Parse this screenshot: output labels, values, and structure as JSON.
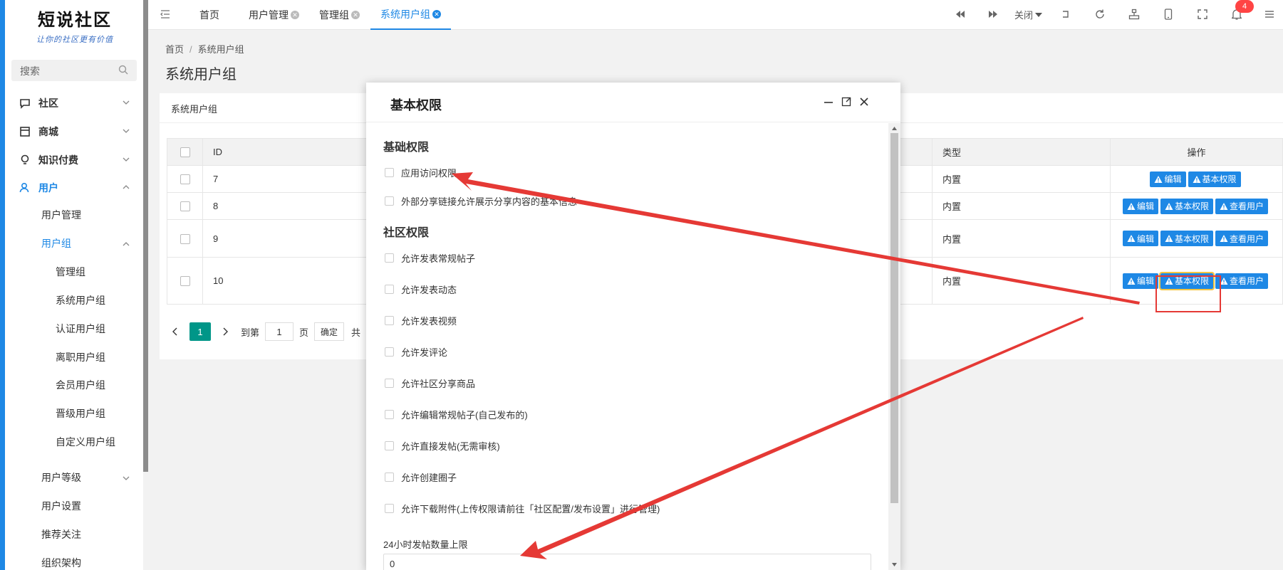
{
  "logo": {
    "title": "短说社区",
    "subtitle": "让你的社区更有价值"
  },
  "search": {
    "placeholder": "搜索"
  },
  "sidebar": {
    "items": [
      {
        "label": "社区",
        "icon": "chat-icon"
      },
      {
        "label": "商城",
        "icon": "store-icon"
      },
      {
        "label": "知识付费",
        "icon": "bulb-icon"
      },
      {
        "label": "用户",
        "icon": "user-icon"
      }
    ],
    "user_sub": [
      {
        "label": "用户管理"
      },
      {
        "label": "用户组"
      }
    ],
    "group_sub": [
      {
        "label": "管理组"
      },
      {
        "label": "系统用户组"
      },
      {
        "label": "认证用户组"
      },
      {
        "label": "离职用户组"
      },
      {
        "label": "会员用户组"
      },
      {
        "label": "晋级用户组"
      },
      {
        "label": "自定义用户组"
      }
    ],
    "user_sub2": [
      {
        "label": "用户等级"
      },
      {
        "label": "用户设置"
      },
      {
        "label": "推荐关注"
      },
      {
        "label": "组织架构"
      }
    ]
  },
  "tabs": [
    {
      "label": "首页"
    },
    {
      "label": "用户管理"
    },
    {
      "label": "管理组"
    },
    {
      "label": "系统用户组"
    }
  ],
  "toolbar": {
    "close_label": "关闭",
    "notification_count": "4"
  },
  "breadcrumb": {
    "home": "首页",
    "current": "系统用户组"
  },
  "page_title": "系统用户组",
  "card_title": "系统用户组",
  "table": {
    "headers": {
      "id": "ID",
      "type": "类型",
      "ops": "操作"
    },
    "rows": [
      {
        "id": "7",
        "type": "内置"
      },
      {
        "id": "8",
        "type": "内置"
      },
      {
        "id": "9",
        "type": "内置"
      },
      {
        "id": "10",
        "type": "内置"
      }
    ],
    "buttons": {
      "edit": "编辑",
      "perm": "基本权限",
      "view_users": "查看用户"
    }
  },
  "pager": {
    "current": "1",
    "goto_label": "到第",
    "page_input": "1",
    "page_unit": "页",
    "confirm": "确定",
    "total_prefix": "共"
  },
  "modal": {
    "title": "基本权限",
    "section_basic": "基础权限",
    "basic_perms": [
      {
        "label": "应用访问权限"
      },
      {
        "label": "外部分享链接允许展示分享内容的基本信息"
      }
    ],
    "section_community": "社区权限",
    "community_perms": [
      {
        "label": "允许发表常规帖子"
      },
      {
        "label": "允许发表动态"
      },
      {
        "label": "允许发表视频"
      },
      {
        "label": "允许发评论"
      },
      {
        "label": "允许社区分享商品"
      },
      {
        "label": "允许编辑常规帖子(自己发布的)"
      },
      {
        "label": "允许直接发帖(无需审核)"
      },
      {
        "label": "允许创建圈子"
      },
      {
        "label": "允许下载附件(上传权限请前往「社区配置/发布设置」进行管理)"
      }
    ],
    "limit_label": "24小时发帖数量上限",
    "limit_value": "0"
  },
  "colors": {
    "accent": "#1e88e5",
    "pager": "#009688",
    "annotation": "#e53935"
  }
}
